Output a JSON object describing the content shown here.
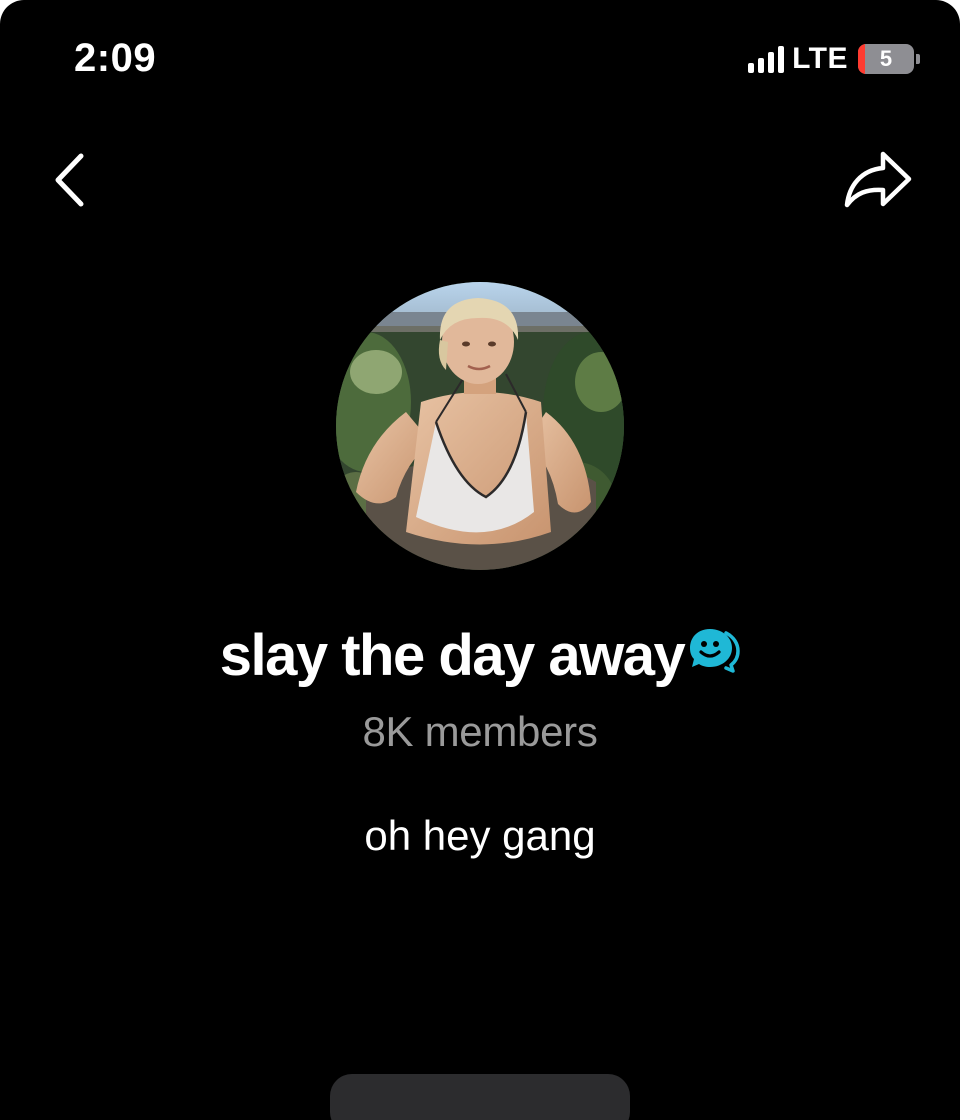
{
  "status_bar": {
    "time": "2:09",
    "network": "LTE",
    "battery_level": "5"
  },
  "nav": {
    "back_icon": "chevron-left-icon",
    "share_icon": "share-arrow-icon"
  },
  "community": {
    "avatar": "profile-photo",
    "name": "slay the day away",
    "badge_icon": "chat-bubble-smile-icon",
    "badge_color": "#1fb8d6",
    "members": "8K members",
    "description": "oh hey gang"
  },
  "colors": {
    "background": "#000000",
    "text_primary": "#ffffff",
    "text_secondary": "#9a9a9a",
    "battery_low": "#ff3b30"
  }
}
